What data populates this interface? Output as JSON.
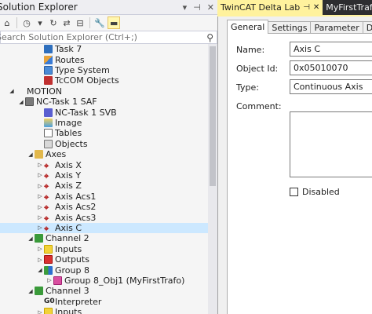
{
  "solution_explorer": {
    "title": "Solution Explorer",
    "search_placeholder": "Search Solution Explorer (Ctrl+;)",
    "tree": [
      {
        "label": "Task 7",
        "indent": 4,
        "expander": "",
        "icon": "task-icon",
        "icls": "i-task"
      },
      {
        "label": "Routes",
        "indent": 4,
        "expander": "",
        "icon": "routes-icon",
        "icls": "i-route"
      },
      {
        "label": "Type System",
        "indent": 4,
        "expander": "",
        "icon": "type-system-icon",
        "icls": "i-type"
      },
      {
        "label": "TcCOM Objects",
        "indent": 4,
        "expander": "",
        "icon": "tccom-objects-icon",
        "icls": "i-tcom"
      },
      {
        "label": "MOTION",
        "indent": 1,
        "expander": "◢",
        "icon": "motion-icon",
        "icls": "i-motion"
      },
      {
        "label": "NC-Task 1 SAF",
        "indent": 2,
        "expander": "◢",
        "icon": "nc-task-icon",
        "icls": "i-nc"
      },
      {
        "label": "NC-Task 1 SVB",
        "indent": 4,
        "expander": "",
        "icon": "svb-task-icon",
        "icls": "i-svb"
      },
      {
        "label": "Image",
        "indent": 4,
        "expander": "",
        "icon": "image-icon",
        "icls": "i-image"
      },
      {
        "label": "Tables",
        "indent": 4,
        "expander": "",
        "icon": "tables-icon",
        "icls": "i-table"
      },
      {
        "label": "Objects",
        "indent": 4,
        "expander": "",
        "icon": "objects-icon",
        "icls": "i-objects"
      },
      {
        "label": "Axes",
        "indent": 3,
        "expander": "◢",
        "icon": "axes-folder-icon",
        "icls": "i-axes"
      },
      {
        "label": "Axis X",
        "indent": 4,
        "expander": "▷",
        "icon": "axis-icon",
        "icls": "i-axis"
      },
      {
        "label": "Axis Y",
        "indent": 4,
        "expander": "▷",
        "icon": "axis-icon",
        "icls": "i-axis"
      },
      {
        "label": "Axis Z",
        "indent": 4,
        "expander": "▷",
        "icon": "axis-icon",
        "icls": "i-axis"
      },
      {
        "label": "Axis Acs1",
        "indent": 4,
        "expander": "▷",
        "icon": "axis-icon",
        "icls": "i-axis"
      },
      {
        "label": "Axis Acs2",
        "indent": 4,
        "expander": "▷",
        "icon": "axis-icon",
        "icls": "i-axis"
      },
      {
        "label": "Axis Acs3",
        "indent": 4,
        "expander": "▷",
        "icon": "axis-icon",
        "icls": "i-axis"
      },
      {
        "label": "Axis C",
        "indent": 4,
        "expander": "▷",
        "icon": "axis-icon",
        "icls": "i-axis",
        "selected": true
      },
      {
        "label": "Channel 2",
        "indent": 3,
        "expander": "◢",
        "icon": "channel-icon",
        "icls": "i-channel"
      },
      {
        "label": "Inputs",
        "indent": 4,
        "expander": "▷",
        "icon": "inputs-icon",
        "icls": "i-inputs"
      },
      {
        "label": "Outputs",
        "indent": 4,
        "expander": "▷",
        "icon": "outputs-icon",
        "icls": "i-outputs"
      },
      {
        "label": "Group 8",
        "indent": 4,
        "expander": "◢",
        "icon": "group-icon",
        "icls": "i-group"
      },
      {
        "label": "Group 8_Obj1 (MyFirstTrafo)",
        "indent": 5,
        "expander": "▷",
        "icon": "group-object-icon",
        "icls": "i-obj"
      },
      {
        "label": "Channel 3",
        "indent": 3,
        "expander": "◢",
        "icon": "channel-icon",
        "icls": "i-channel"
      },
      {
        "label": "Interpreter",
        "indent": 4,
        "expander": "",
        "icon": "interpreter-icon",
        "icls": "i-go",
        "glyph": "G0"
      },
      {
        "label": "Inputs",
        "indent": 4,
        "expander": "▷",
        "icon": "inputs-icon",
        "icls": "i-inputs"
      }
    ]
  },
  "editor": {
    "doc_tabs": [
      {
        "label": "TwinCAT Delta Lab",
        "active": true
      },
      {
        "label": "MyFirstTrafo.cpp",
        "active": false
      }
    ],
    "property_tabs": [
      "General",
      "Settings",
      "Parameter",
      "Dynamics"
    ],
    "fields": {
      "name_label": "Name:",
      "name_value": "Axis C",
      "object_id_label": "Object Id:",
      "object_id_value": "0x05010070",
      "type_label": "Type:",
      "type_value": "Continuous Axis",
      "comment_label": "Comment:",
      "disabled_label": "Disabled"
    }
  },
  "colors": {
    "active_doc_tab": "#fff29d",
    "selection": "#cce8ff",
    "dark_chrome": "#2d2d30"
  }
}
